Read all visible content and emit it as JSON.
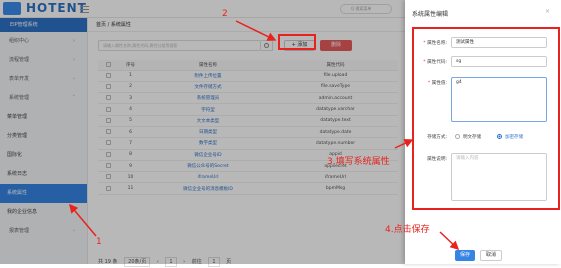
{
  "app": {
    "logo_text": "HOTENT",
    "search_placeholder": "Q 搜索菜单"
  },
  "sidebar": {
    "header": "EIP管理系统",
    "items": [
      {
        "label": "组织中心"
      },
      {
        "label": "流程管理"
      },
      {
        "label": "表单开发"
      },
      {
        "label": "系统管理"
      },
      {
        "label": "菜单管理"
      },
      {
        "label": "分类管理"
      },
      {
        "label": "国际化"
      },
      {
        "label": "系统日志"
      },
      {
        "label": "系统属性"
      },
      {
        "label": "我的企业信息"
      },
      {
        "label": "报表管理"
      }
    ]
  },
  "main": {
    "breadcrumb": "首页 / 系统属性",
    "search_placeholder": "请输入属性名称,属性代码,属性分组等搜索",
    "add_label": "+ 添加",
    "delete_label": "删除",
    "table": {
      "headers": [
        "序号",
        "属性名称",
        "属性代码"
      ],
      "rows": [
        {
          "no": "1",
          "name": "附件上传位置",
          "code": "file.upload"
        },
        {
          "no": "2",
          "name": "文件存储方式",
          "code": "file.saveType"
        },
        {
          "no": "3",
          "name": "系统管理员",
          "code": "admin.account"
        },
        {
          "no": "4",
          "name": "字符型",
          "code": "datatype.varchar"
        },
        {
          "no": "5",
          "name": "大文本类型",
          "code": "datatype.text"
        },
        {
          "no": "6",
          "name": "日期类型",
          "code": "datatype.date"
        },
        {
          "no": "7",
          "name": "数字类型",
          "code": "datatype.number"
        },
        {
          "no": "8",
          "name": "微信企业号ID",
          "code": "appid"
        },
        {
          "no": "9",
          "name": "微信公众号的Secret",
          "code": "appsecret"
        },
        {
          "no": "10",
          "name": "iframeUrl",
          "code": "iframeUrl"
        },
        {
          "no": "11",
          "name": "微信企业号的消息模板ID",
          "code": "bpmMsg"
        }
      ]
    },
    "pager": {
      "total": "共 19 条",
      "page_size": "20条/页",
      "goto_label": "前往",
      "page": "1",
      "page_unit": "页"
    }
  },
  "panel": {
    "title": "系统属性编辑",
    "close": "×",
    "fields": {
      "name_label": "属性名称:",
      "name_value": "测试属性",
      "code_label": "属性代码:",
      "code_value": "sg",
      "value_label": "属性值:",
      "value_value": "g4",
      "storage_label": "存储方式:",
      "storage_opt1": "明文存储",
      "storage_opt2": "加密存储",
      "desc_label": "属性说明:",
      "desc_placeholder": "请输入内容"
    },
    "save_label": "保存",
    "cancel_label": "取消"
  },
  "annotations": {
    "a1": "1",
    "a2": "2",
    "a3": "3.填写系统属性",
    "a4": "4.点击保存"
  },
  "colors": {
    "accent": "#3584e4",
    "annotation": "#e8231f",
    "danger": "#e65c5c"
  }
}
